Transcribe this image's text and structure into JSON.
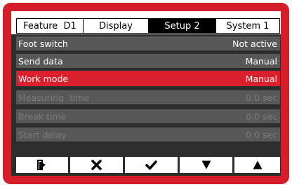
{
  "tabs": [
    {
      "label": "Feature  D1",
      "active": false
    },
    {
      "label": "Display",
      "active": false
    },
    {
      "label": "Setup 2",
      "active": true
    },
    {
      "label": "System 1",
      "active": false
    }
  ],
  "rows": [
    {
      "label": "Foot switch",
      "value": "Not active",
      "state": "normal"
    },
    {
      "label": "Send data",
      "value": "Manual",
      "state": "normal"
    },
    {
      "label": "Work mode",
      "value": "Manual",
      "state": "selected"
    },
    {
      "label": "Measuring  time",
      "value": "0.0 sec",
      "state": "disabled"
    },
    {
      "label": "Break time",
      "value": "0.0 sec",
      "state": "disabled"
    },
    {
      "label": "Start delay",
      "value": "0.0 sec",
      "state": "disabled"
    }
  ],
  "buttons": [
    {
      "icon": "exit-icon"
    },
    {
      "icon": "cancel-icon"
    },
    {
      "icon": "confirm-icon"
    },
    {
      "icon": "arrow-down-icon"
    },
    {
      "icon": "arrow-up-icon"
    }
  ],
  "colors": {
    "frame": "#d41f2b",
    "selected_row": "#d9202c",
    "row": "#585858",
    "panel": "#2d2d2d",
    "disabled_text": "#7a7a7a"
  }
}
